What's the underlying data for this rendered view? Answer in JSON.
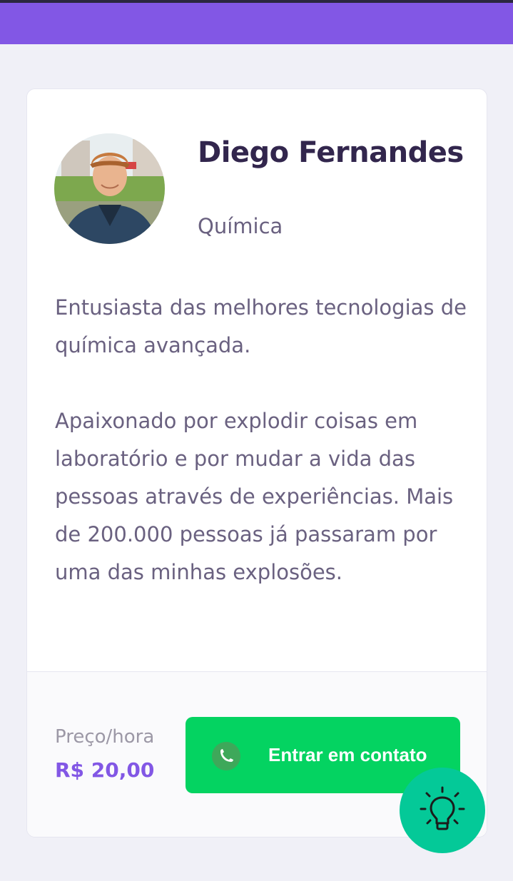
{
  "teacher": {
    "name": "Diego Fernandes",
    "subject": "Química",
    "bio": [
      "Entusiasta das melhores tecnologias de química avançada.",
      "Apaixonado por explodir coisas em laboratório e por mudar a vida das pessoas através de experiências. Mais de 200.000 pessoas já passaram por uma das minhas explosões."
    ]
  },
  "footer": {
    "price_label": "Preço/hora",
    "price_value": "R$ 20,00",
    "contact_label": "Entrar em contato"
  },
  "icons": {
    "contact": "whatsapp-icon",
    "floating": "lightbulb-icon"
  },
  "colors": {
    "primary": "#8257E5",
    "success": "#04D361",
    "tip": "#04C998",
    "title": "#32264D",
    "text": "#6A6180"
  }
}
